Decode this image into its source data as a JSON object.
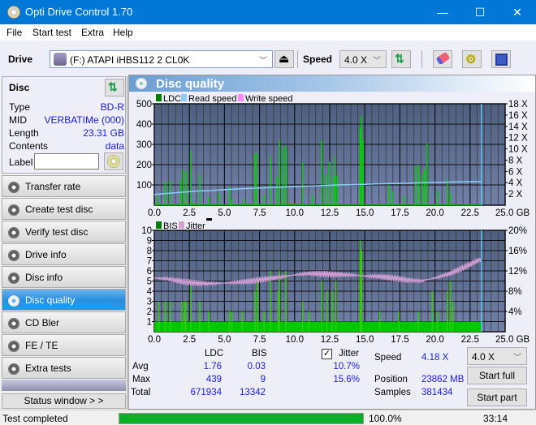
{
  "window": {
    "title": "Opti Drive Control 1.70",
    "minimize": "—",
    "maximize": "☐",
    "close": "✕"
  },
  "menu": [
    "File",
    "Start test",
    "Extra",
    "Help"
  ],
  "toolbar": {
    "drive_label": "Drive",
    "drive_value": "(F:)  ATAPI iHBS112  2 CL0K",
    "speed_label": "Speed",
    "speed_value": "4.0 X"
  },
  "disc": {
    "header": "Disc",
    "rows": [
      {
        "k": "Type",
        "v": "BD-R"
      },
      {
        "k": "MID",
        "v": "VERBATIMe (000)"
      },
      {
        "k": "Length",
        "v": "23.31 GB"
      },
      {
        "k": "Contents",
        "v": "data"
      }
    ],
    "label_key": "Label",
    "label_value": ""
  },
  "nav": [
    "Transfer rate",
    "Create test disc",
    "Verify test disc",
    "Drive info",
    "Disc info",
    "Disc quality",
    "CD Bler",
    "FE / TE",
    "Extra tests"
  ],
  "nav_active": "Disc quality",
  "status_window": "Status window > >",
  "panel": {
    "title": "Disc quality"
  },
  "chart_data": [
    {
      "type": "bar",
      "title": "LDC",
      "legend": [
        "LDC",
        "Read speed",
        "Write speed"
      ],
      "legend_colors": [
        "#008000",
        "#87cefa",
        "#ff88ff"
      ],
      "xlabel": "GB",
      "xlim": [
        0,
        25
      ],
      "xticks": [
        "0.0",
        "2.5",
        "5.0",
        "7.5",
        "10.0",
        "12.5",
        "15.0",
        "17.5",
        "20.0",
        "22.5",
        "25.0 GB"
      ],
      "ylim": [
        0,
        500
      ],
      "yticks": [
        "100",
        "200",
        "300",
        "400",
        "500"
      ],
      "y2lim": [
        0,
        18
      ],
      "y2ticks": [
        "2 X",
        "4 X",
        "6 X",
        "8 X",
        "10 X",
        "12 X",
        "14 X",
        "16 X",
        "18 X"
      ],
      "ldc_spikes": [
        [
          0.2,
          45
        ],
        [
          0.8,
          115
        ],
        [
          1.2,
          120
        ],
        [
          2.0,
          130
        ],
        [
          2.2,
          180
        ],
        [
          2.4,
          170
        ],
        [
          2.8,
          270
        ],
        [
          3.0,
          20
        ],
        [
          3.5,
          150
        ],
        [
          4.2,
          40
        ],
        [
          5.0,
          60
        ],
        [
          5.8,
          90
        ],
        [
          6.0,
          30
        ],
        [
          7.0,
          30
        ],
        [
          7.8,
          250
        ],
        [
          7.9,
          260
        ],
        [
          8.5,
          50
        ],
        [
          9.0,
          245
        ],
        [
          9.5,
          140
        ],
        [
          9.7,
          320
        ],
        [
          10.0,
          285
        ],
        [
          10.2,
          295
        ],
        [
          11.5,
          215
        ],
        [
          12.3,
          50
        ],
        [
          13.0,
          320
        ],
        [
          13.3,
          150
        ],
        [
          13.6,
          215
        ],
        [
          13.9,
          140
        ],
        [
          14.0,
          240
        ],
        [
          14.2,
          145
        ],
        [
          16.0,
          380
        ],
        [
          16.1,
          440
        ],
        [
          16.2,
          320
        ],
        [
          18.2,
          100
        ],
        [
          18.5,
          70
        ],
        [
          19.4,
          50
        ],
        [
          20.3,
          190
        ],
        [
          20.5,
          200
        ],
        [
          20.8,
          155
        ],
        [
          21.0,
          180
        ],
        [
          21.2,
          305
        ],
        [
          22.0,
          70
        ],
        [
          22.8,
          130
        ],
        [
          23.0,
          60
        ]
      ],
      "read_speed": [
        [
          0,
          1.9
        ],
        [
          1,
          2.1
        ],
        [
          2,
          2.3
        ],
        [
          3,
          2.5
        ],
        [
          4,
          2.6
        ],
        [
          5,
          2.75
        ],
        [
          6,
          2.9
        ],
        [
          7,
          3.0
        ],
        [
          8,
          3.1
        ],
        [
          9,
          3.2
        ],
        [
          10,
          3.3
        ],
        [
          11,
          3.4
        ],
        [
          12,
          3.5
        ],
        [
          13,
          3.6
        ],
        [
          14,
          3.65
        ],
        [
          15,
          3.7
        ],
        [
          16,
          3.8
        ],
        [
          17,
          3.85
        ],
        [
          18,
          3.9
        ],
        [
          19,
          4.0
        ],
        [
          20,
          4.05
        ],
        [
          21,
          4.1
        ],
        [
          22,
          4.15
        ],
        [
          23.3,
          4.18
        ]
      ],
      "end_marker_gb": 23.31
    },
    {
      "type": "bar",
      "title": "BIS",
      "legend": [
        "BIS",
        "Jitter"
      ],
      "legend_colors": [
        "#008000",
        "#d8a0d8"
      ],
      "xlabel": "GB",
      "xlim": [
        0,
        25
      ],
      "xticks": [
        "0.0",
        "2.5",
        "5.0",
        "7.5",
        "10.0",
        "12.5",
        "15.0",
        "17.5",
        "20.0",
        "22.5",
        "25.0 GB"
      ],
      "ylim": [
        0,
        10
      ],
      "yticks": [
        "1",
        "2",
        "3",
        "4",
        "5",
        "6",
        "7",
        "8",
        "9",
        "10"
      ],
      "y2lim": [
        0,
        20
      ],
      "y2ticks": [
        "4%",
        "8%",
        "12%",
        "16%",
        "20%"
      ],
      "bis_spikes": [
        [
          0.3,
          3
        ],
        [
          0.8,
          3
        ],
        [
          1.2,
          3
        ],
        [
          2.1,
          3
        ],
        [
          2.3,
          3
        ],
        [
          2.4,
          3
        ],
        [
          2.8,
          5
        ],
        [
          3.5,
          3
        ],
        [
          4.2,
          2
        ],
        [
          5.8,
          2
        ],
        [
          6.0,
          2
        ],
        [
          6.8,
          2
        ],
        [
          7.8,
          4
        ],
        [
          8.0,
          5
        ],
        [
          8.5,
          2
        ],
        [
          9.0,
          6
        ],
        [
          9.6,
          4
        ],
        [
          9.7,
          6
        ],
        [
          10.2,
          6
        ],
        [
          11.5,
          3
        ],
        [
          12.0,
          2
        ],
        [
          13.0,
          5
        ],
        [
          13.4,
          4
        ],
        [
          13.8,
          4
        ],
        [
          14.1,
          5
        ],
        [
          16.0,
          9
        ],
        [
          16.1,
          8
        ],
        [
          17.5,
          2
        ],
        [
          19.0,
          2
        ],
        [
          20.5,
          2
        ],
        [
          21.6,
          4
        ],
        [
          22.0,
          2
        ],
        [
          22.8,
          4
        ],
        [
          23.0,
          5
        ],
        [
          23.2,
          3
        ]
      ],
      "jitter": [
        [
          0,
          10.6
        ],
        [
          1,
          10.4
        ],
        [
          2,
          9.9
        ],
        [
          3,
          9.6
        ],
        [
          4,
          9.5
        ],
        [
          5,
          9.6
        ],
        [
          6,
          9.8
        ],
        [
          7,
          10.0
        ],
        [
          8,
          10.4
        ],
        [
          9,
          10.8
        ],
        [
          10,
          11.2
        ],
        [
          11,
          11.5
        ],
        [
          12,
          11.4
        ],
        [
          13,
          11.3
        ],
        [
          14,
          11.2
        ],
        [
          15,
          11.0
        ],
        [
          16,
          10.9
        ],
        [
          17,
          10.6
        ],
        [
          18,
          10.2
        ],
        [
          19,
          10.0
        ],
        [
          20,
          10.6
        ],
        [
          21,
          11.4
        ],
        [
          22,
          12.6
        ],
        [
          23,
          14.0
        ],
        [
          23.3,
          14.2
        ]
      ],
      "end_marker_gb": 23.31
    }
  ],
  "stats": {
    "col_ldc": "LDC",
    "col_bis": "BIS",
    "jitter_label": "Jitter",
    "jitter_checked": true,
    "rows": [
      {
        "k": "Avg",
        "ldc": "1.76",
        "bis": "0.03",
        "jit": "10.7%"
      },
      {
        "k": "Max",
        "ldc": "439",
        "bis": "9",
        "jit": "15.6%"
      },
      {
        "k": "Total",
        "ldc": "671934",
        "bis": "13342",
        "jit": ""
      }
    ],
    "speed_label": "Speed",
    "speed_value": "4.18 X",
    "position_label": "Position",
    "position_value": "23862 MB",
    "samples_label": "Samples",
    "samples_value": "381434",
    "speed_select": "4.0 X",
    "start_full": "Start full",
    "start_part": "Start part"
  },
  "statusbar": {
    "text": "Test completed",
    "progress": 100.0,
    "progress_label": "100.0%",
    "time": "33:14"
  }
}
